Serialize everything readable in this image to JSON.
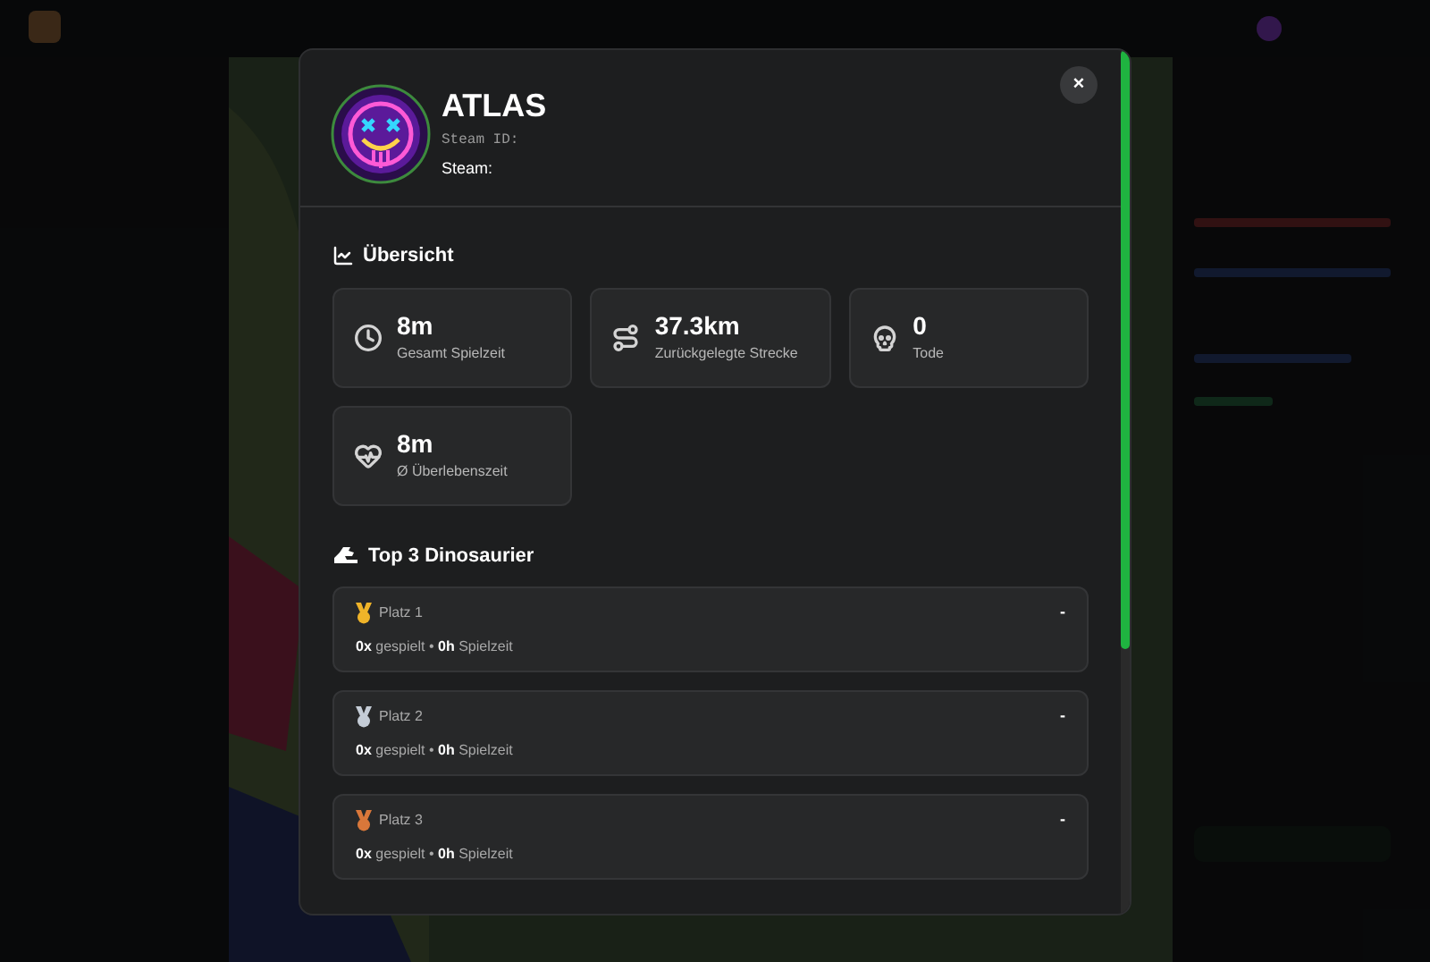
{
  "player": {
    "name": "ATLAS",
    "steam_id_label": "Steam ID:",
    "steam_label": "Steam:"
  },
  "close_label": "×",
  "overview": {
    "title": "Übersicht",
    "stats": [
      {
        "kind": "time",
        "value": "8m",
        "label": "Gesamt Spielzeit"
      },
      {
        "kind": "distance",
        "value": "37.3km",
        "label": "Zurückgelegte Strecke"
      },
      {
        "kind": "deaths",
        "value": "0",
        "label": "Tode"
      },
      {
        "kind": "survival",
        "value": "8m",
        "label": "Ø Überlebenszeit"
      }
    ]
  },
  "top_dinos": {
    "title": "Top 3 Dinosaurier",
    "items": [
      {
        "rank": "Platz 1",
        "color": "#f0b429",
        "name": "-",
        "count": "0x",
        "count_label": "gespielt",
        "separator": "•",
        "hours": "0h",
        "hours_label": "Spielzeit"
      },
      {
        "rank": "Platz 2",
        "color": "#c4ccd6",
        "name": "-",
        "count": "0x",
        "count_label": "gespielt",
        "separator": "•",
        "hours": "0h",
        "hours_label": "Spielzeit"
      },
      {
        "rank": "Platz 3",
        "color": "#d9773a",
        "name": "-",
        "count": "0x",
        "count_label": "gespielt",
        "separator": "•",
        "hours": "0h",
        "hours_label": "Spielzeit"
      }
    ]
  }
}
